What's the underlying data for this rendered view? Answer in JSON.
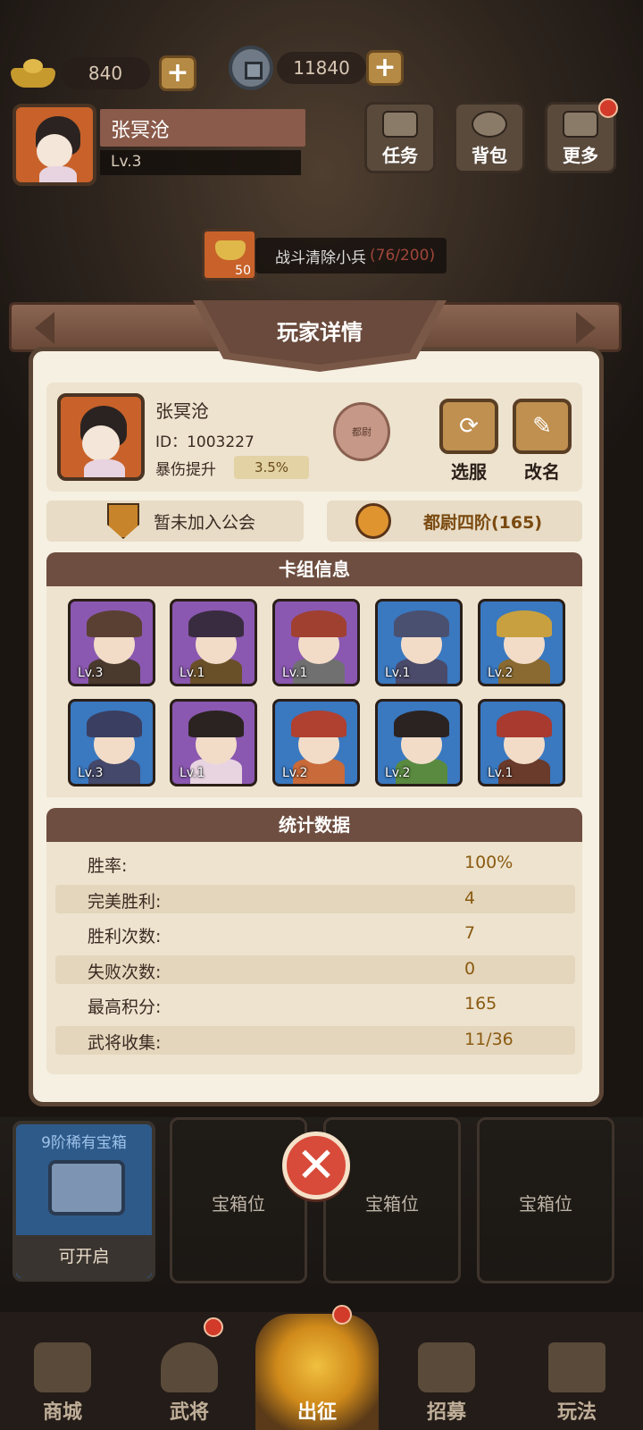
{
  "currency": {
    "gold": "840",
    "coins": "11840"
  },
  "player": {
    "name": "张冥沧",
    "level": "Lv.3"
  },
  "top_buttons": [
    {
      "label": "任务"
    },
    {
      "label": "背包"
    },
    {
      "label": "更多"
    }
  ],
  "quest": {
    "reward": "50",
    "text": "战斗清除小兵",
    "progress": "(76/200)"
  },
  "panel": {
    "title": "玩家详情",
    "name": "张冥沧",
    "id_text": "ID：1003227",
    "buff_label": "暴伤提升",
    "buff_value": "3.5%",
    "rank_seal": "都尉",
    "server_button": "选服",
    "rename_button": "改名",
    "guild": "暂未加入公会",
    "rank": "都尉四阶(165)",
    "deck_title": "卡组信息",
    "stats_title": "统计数据"
  },
  "deck": [
    {
      "level": "Lv.3",
      "color": "purple"
    },
    {
      "level": "Lv.1",
      "color": "purple"
    },
    {
      "level": "Lv.1",
      "color": "purple"
    },
    {
      "level": "Lv.1",
      "color": "blue"
    },
    {
      "level": "Lv.2",
      "color": "blue"
    },
    {
      "level": "Lv.3",
      "color": "blue"
    },
    {
      "level": "Lv.1",
      "color": "purple"
    },
    {
      "level": "Lv.2",
      "color": "blue"
    },
    {
      "level": "Lv.2",
      "color": "blue"
    },
    {
      "level": "Lv.1",
      "color": "blue"
    }
  ],
  "stats": [
    {
      "label": "胜率:",
      "value": "100%"
    },
    {
      "label": "完美胜利:",
      "value": "4"
    },
    {
      "label": "胜利次数:",
      "value": "7"
    },
    {
      "label": "失败次数:",
      "value": "0"
    },
    {
      "label": "最高积分:",
      "value": "165"
    },
    {
      "label": "武将收集:",
      "value": "11/36"
    }
  ],
  "slots": {
    "chest_title": "9阶稀有宝箱",
    "chest_action": "可开启",
    "empty_label": "宝箱位"
  },
  "nav": [
    {
      "label": "商城"
    },
    {
      "label": "武将"
    },
    {
      "label": "出征"
    },
    {
      "label": "招募"
    },
    {
      "label": "玩法"
    }
  ],
  "colors": {
    "purple": "#8a58b0",
    "blue": "#3a78c0",
    "accent_red": "#d84a3a"
  }
}
